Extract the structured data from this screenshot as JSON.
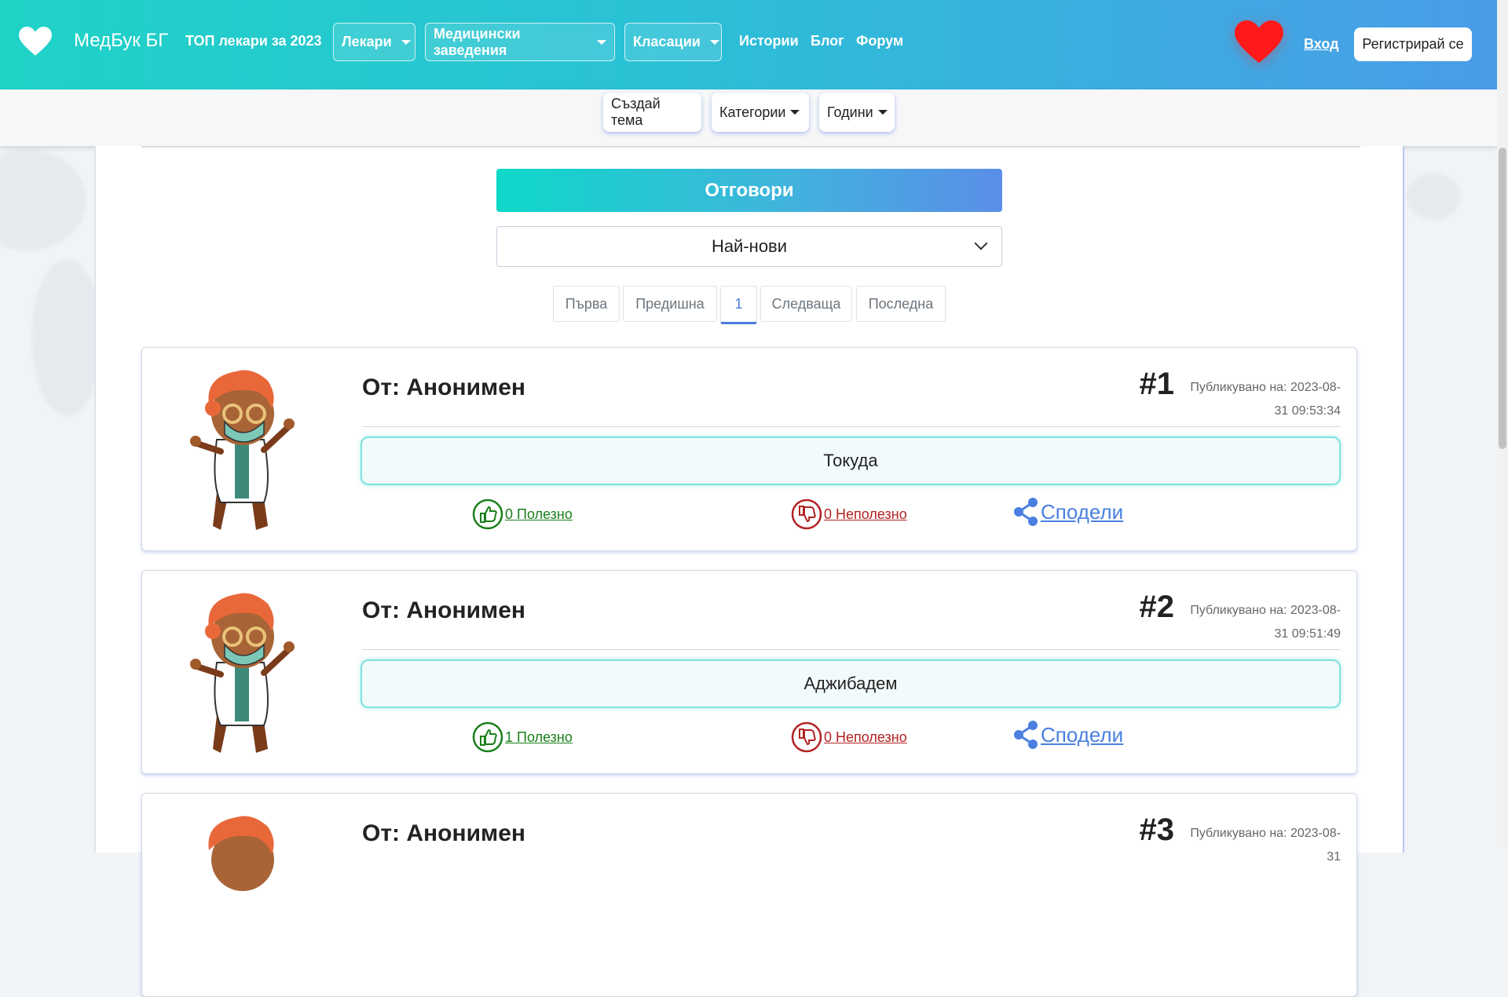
{
  "nav": {
    "brand": "МедБук БГ",
    "top_doctors": "ТОП лекари за 2023",
    "doctors": "Лекари",
    "institutions": "Медицински заведения",
    "rankings": "Класации",
    "stories": "Истории",
    "blog": "Блог",
    "forum": "Форум",
    "login": "Вход",
    "register": "Регистрирай се"
  },
  "subnav": {
    "create_topic": "Създай тема",
    "categories": "Категории",
    "years": "Години"
  },
  "answers_title": "Отговори",
  "sort": {
    "selected": "Най-нови"
  },
  "pagination": [
    "Първа",
    "Предишна",
    "1",
    "Следваща",
    "Последна"
  ],
  "answers": [
    {
      "author": "От: Анонимен",
      "number": "#1",
      "published": "Публикувано на: 2023-08-31 09:53:34",
      "text": "Токуда",
      "useful": "0 Полезно",
      "useless": "0 Неполезно",
      "share": "Сподели"
    },
    {
      "author": "От: Анонимен",
      "number": "#2",
      "published": "Публикувано на: 2023-08-31 09:51:49",
      "text": "Аджибадем",
      "useful": "1 Полезно",
      "useless": "0 Неполезно",
      "share": "Сподели"
    },
    {
      "author": "От: Анонимен",
      "number": "#3",
      "published": "Публикувано на: 2023-08-31",
      "text": "",
      "useful": "",
      "useless": "",
      "share": ""
    }
  ],
  "colors": {
    "nav_gradient_start": "#1fd3c6",
    "nav_gradient_end": "#4a9ce8",
    "useful": "#1a7f1a",
    "useless": "#b22222",
    "share": "#4a7fe0",
    "heart": "#ff1a1a"
  },
  "icons": [
    "heart-logo-icon",
    "caret-down-icon",
    "heart-icon",
    "thumbs-up-icon",
    "thumbs-down-icon",
    "share-icon",
    "chevron-down-icon"
  ]
}
